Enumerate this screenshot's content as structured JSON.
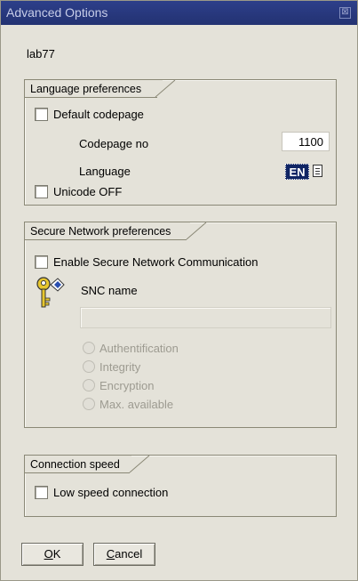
{
  "window": {
    "title": "Advanced Options",
    "close_glyph": "⊠"
  },
  "system_id": "lab77",
  "language_prefs": {
    "title": "Language preferences",
    "default_codepage_label": "Default codepage",
    "default_codepage_checked": false,
    "codepage_no_label": "Codepage no",
    "codepage_no_value": "1100",
    "language_label": "Language",
    "language_value": "EN",
    "unicode_off_label": "Unicode OFF",
    "unicode_off_checked": false
  },
  "secure_network": {
    "title": "Secure Network preferences",
    "enable_snc_label": "Enable Secure Network Communication",
    "enable_snc_checked": false,
    "snc_name_label": "SNC name",
    "snc_name_value": "",
    "icon": "key-lock-icon",
    "options": [
      "Authentification",
      "Integrity",
      "Encryption",
      "Max. available"
    ]
  },
  "connection_speed": {
    "title": "Connection speed",
    "low_speed_label": "Low speed connection",
    "low_speed_checked": false
  },
  "buttons": {
    "ok_mnemonic": "O",
    "ok_rest": "K",
    "cancel_mnemonic": "C",
    "cancel_rest": "ancel"
  },
  "colors": {
    "titlebar": "#233272",
    "selected_language_bg": "#0f2464"
  }
}
